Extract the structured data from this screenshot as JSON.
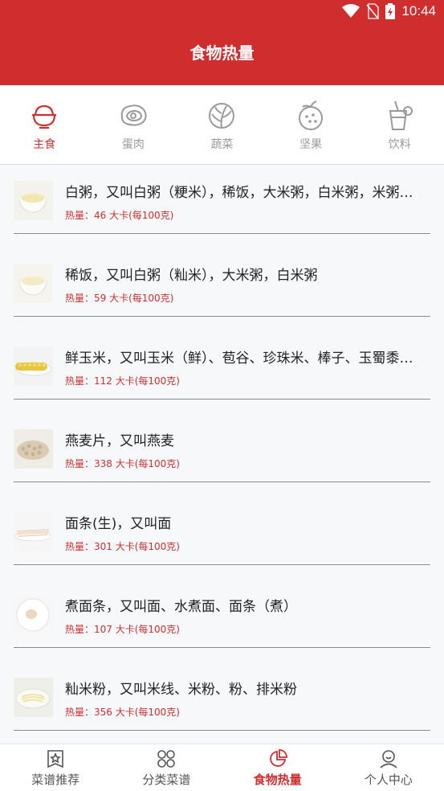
{
  "status": {
    "time": "10:44"
  },
  "header": {
    "title": "食物热量"
  },
  "tabs": [
    {
      "label": "主食",
      "icon": "rice-bowl-icon",
      "active": true
    },
    {
      "label": "蛋肉",
      "icon": "meat-icon",
      "active": false
    },
    {
      "label": "蔬菜",
      "icon": "cabbage-icon",
      "active": false
    },
    {
      "label": "坚果",
      "icon": "fruit-icon",
      "active": false
    },
    {
      "label": "饮料",
      "icon": "drink-cup-icon",
      "active": false
    }
  ],
  "foods": [
    {
      "name": "白粥，又叫白粥（粳米），稀饭，大米粥，白米粥，米粥，江米粥",
      "calorie": "热量：46 大卡(每100克)",
      "thumb": "porridge-thumb"
    },
    {
      "name": "稀饭，又叫白粥（籼米），大米粥，白米粥",
      "calorie": "热量：59 大卡(每100克)",
      "thumb": "porridge-thumb"
    },
    {
      "name": "鲜玉米，又叫玉米（鲜）、苞谷、珍珠米、棒子、玉蜀黍、玉麦",
      "calorie": "热量：112 大卡(每100克)",
      "thumb": "corn-thumb"
    },
    {
      "name": "燕麦片，又叫燕麦",
      "calorie": "热量：338 大卡(每100克)",
      "thumb": "oats-thumb"
    },
    {
      "name": "面条(生)，又叫面",
      "calorie": "热量：301 大卡(每100克)",
      "thumb": "noodles-raw-thumb"
    },
    {
      "name": "煮面条，又叫面、水煮面、面条（煮）",
      "calorie": "热量：107 大卡(每100克)",
      "thumb": "noodles-cooked-thumb"
    },
    {
      "name": "籼米粉，又叫米线、米粉、粉、排米粉",
      "calorie": "热量：356 大卡(每100克)",
      "thumb": "rice-noodle-thumb"
    }
  ],
  "bottom_nav": [
    {
      "label": "菜谱推荐",
      "icon": "star-bookmark-icon",
      "active": false
    },
    {
      "label": "分类菜谱",
      "icon": "grid-icon",
      "active": false
    },
    {
      "label": "食物热量",
      "icon": "pie-chart-icon",
      "active": true
    },
    {
      "label": "个人中心",
      "icon": "person-icon",
      "active": false
    }
  ],
  "colors": {
    "primary": "#d02e2e",
    "inactive": "#9a9a9a"
  }
}
